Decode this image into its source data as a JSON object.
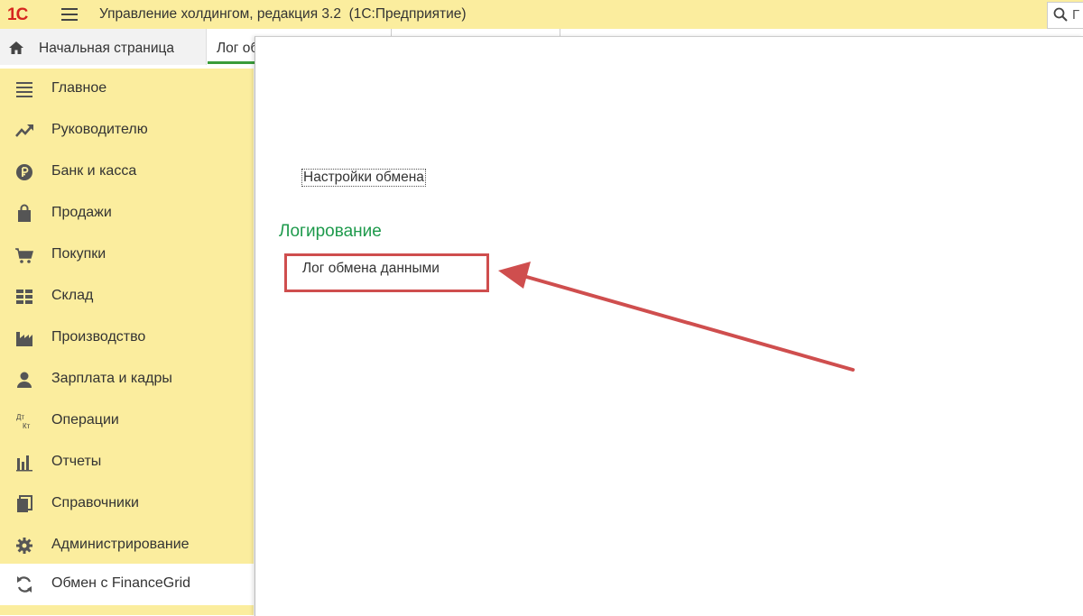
{
  "titlebar": {
    "logo": "1С",
    "title": "Управление холдингом, редакция 3.2  (1С:Предприятие)",
    "search_text": "Г"
  },
  "tabs": {
    "home_label": "Начальная страница",
    "active_label": "Лог обмена данными"
  },
  "sidebar": {
    "items": [
      {
        "label": "Главное",
        "icon": "menu-lines-icon"
      },
      {
        "label": "Руководителю",
        "icon": "trend-up-icon"
      },
      {
        "label": "Банк и касса",
        "icon": "ruble-icon"
      },
      {
        "label": "Продажи",
        "icon": "shopping-bag-icon"
      },
      {
        "label": "Покупки",
        "icon": "cart-icon"
      },
      {
        "label": "Склад",
        "icon": "warehouse-grid-icon"
      },
      {
        "label": "Производство",
        "icon": "factory-icon"
      },
      {
        "label": "Зарплата и кадры",
        "icon": "person-icon"
      },
      {
        "label": "Операции",
        "icon": "dt-kt-icon",
        "icon_text_top": "Дт",
        "icon_text_bottom": "Кт"
      },
      {
        "label": "Отчеты",
        "icon": "bar-chart-icon"
      },
      {
        "label": "Справочники",
        "icon": "books-icon"
      },
      {
        "label": "Администрирование",
        "icon": "gear-icon"
      },
      {
        "label": "Обмен с FinanceGrid",
        "icon": "sync-icon",
        "active": true
      }
    ]
  },
  "content": {
    "settings_link": "Настройки обмена",
    "section_title": "Логирование",
    "log_link": "Лог обмена данными"
  },
  "colors": {
    "sidebar_bg": "#fbed9e",
    "section_title": "#1e9a4c",
    "annotation": "#cf4e4e",
    "logo": "#d6261f",
    "active_tab_underline": "#3a9c3a"
  }
}
